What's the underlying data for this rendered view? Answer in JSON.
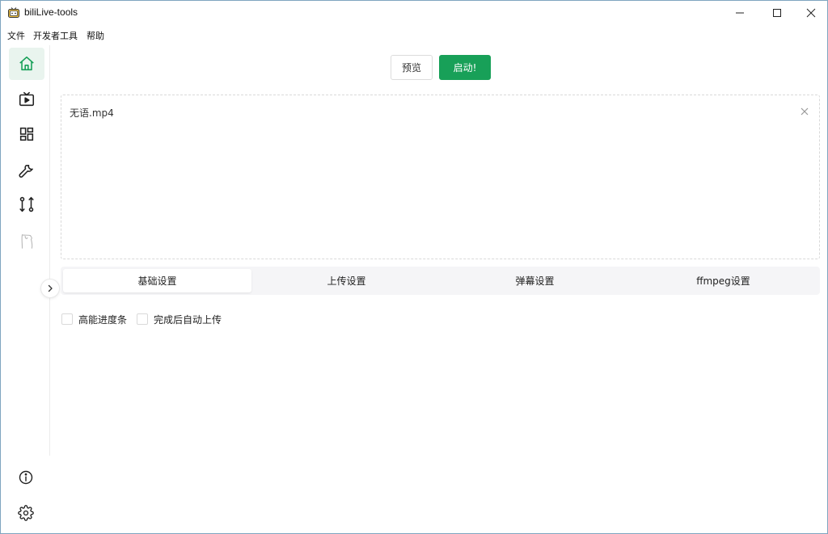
{
  "window": {
    "title": "biliLive-tools"
  },
  "menu": {
    "file": "文件",
    "developer_tools": "开发者工具",
    "help": "帮助"
  },
  "sidebar": {
    "items": [
      {
        "icon": "home-icon",
        "active": true
      },
      {
        "icon": "tv-icon",
        "active": false
      },
      {
        "icon": "dashboard-icon",
        "active": false
      },
      {
        "icon": "wrench-icon",
        "active": false
      },
      {
        "icon": "git-compare-icon",
        "active": false
      },
      {
        "icon": "drawing-icon",
        "active": false
      }
    ],
    "bottom": [
      {
        "icon": "info-icon"
      },
      {
        "icon": "settings-icon"
      }
    ]
  },
  "toolbar": {
    "preview_label": "预览",
    "start_label": "启动!"
  },
  "files": [
    {
      "name": "无语.mp4"
    }
  ],
  "tabs": [
    {
      "label": "基础设置",
      "active": true
    },
    {
      "label": "上传设置",
      "active": false
    },
    {
      "label": "弹幕设置",
      "active": false
    },
    {
      "label": "ffmpeg设置",
      "active": false
    }
  ],
  "options": [
    {
      "label": "高能进度条",
      "checked": false
    },
    {
      "label": "完成后自动上传",
      "checked": false
    }
  ],
  "colors": {
    "accent": "#18a058",
    "active_bg": "#e9f4ee",
    "tab_bar_bg": "#f5f5f7"
  }
}
